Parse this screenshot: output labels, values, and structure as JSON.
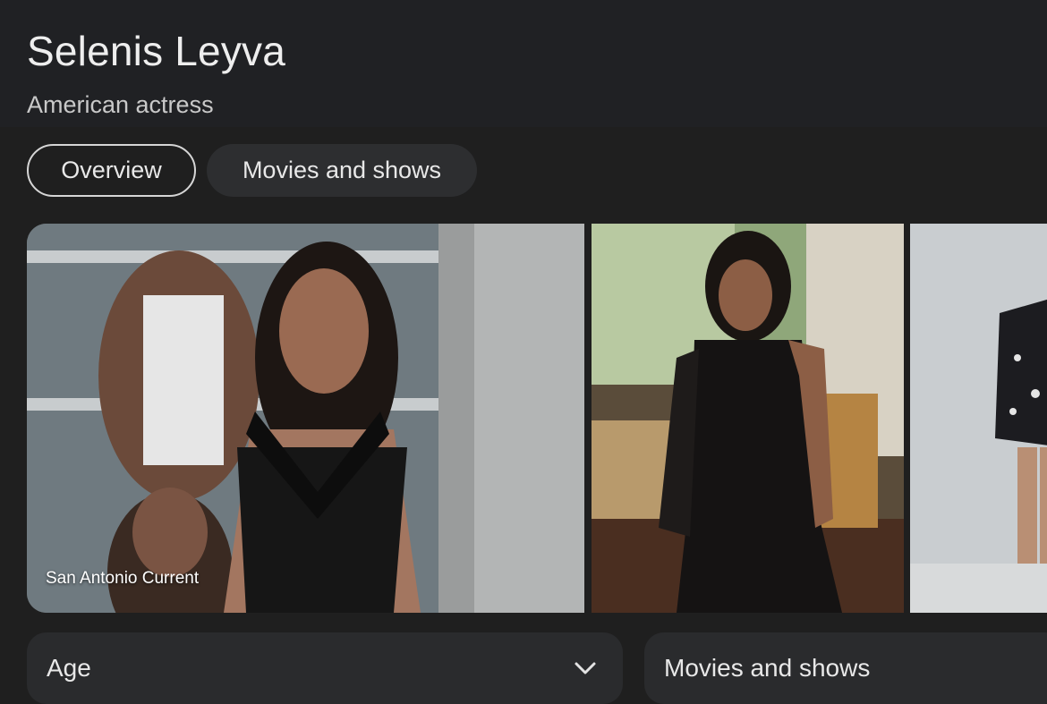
{
  "entity": {
    "name": "Selenis Leyva",
    "description": "American actress"
  },
  "tabs": [
    {
      "label": "Overview",
      "selected": true
    },
    {
      "label": "Movies and shows",
      "selected": false
    }
  ],
  "gallery": {
    "images": [
      {
        "source": "San Antonio Current"
      },
      {
        "source": ""
      },
      {
        "source": ""
      }
    ]
  },
  "cards": {
    "age": {
      "label": "Age",
      "icon": "chevron-down-icon"
    },
    "movies": {
      "label": "Movies and shows"
    }
  },
  "colors": {
    "background": "#1f1f1f",
    "chip_background": "#2d2e30",
    "card_background": "#2a2b2d",
    "text": "#e3e3e3"
  }
}
